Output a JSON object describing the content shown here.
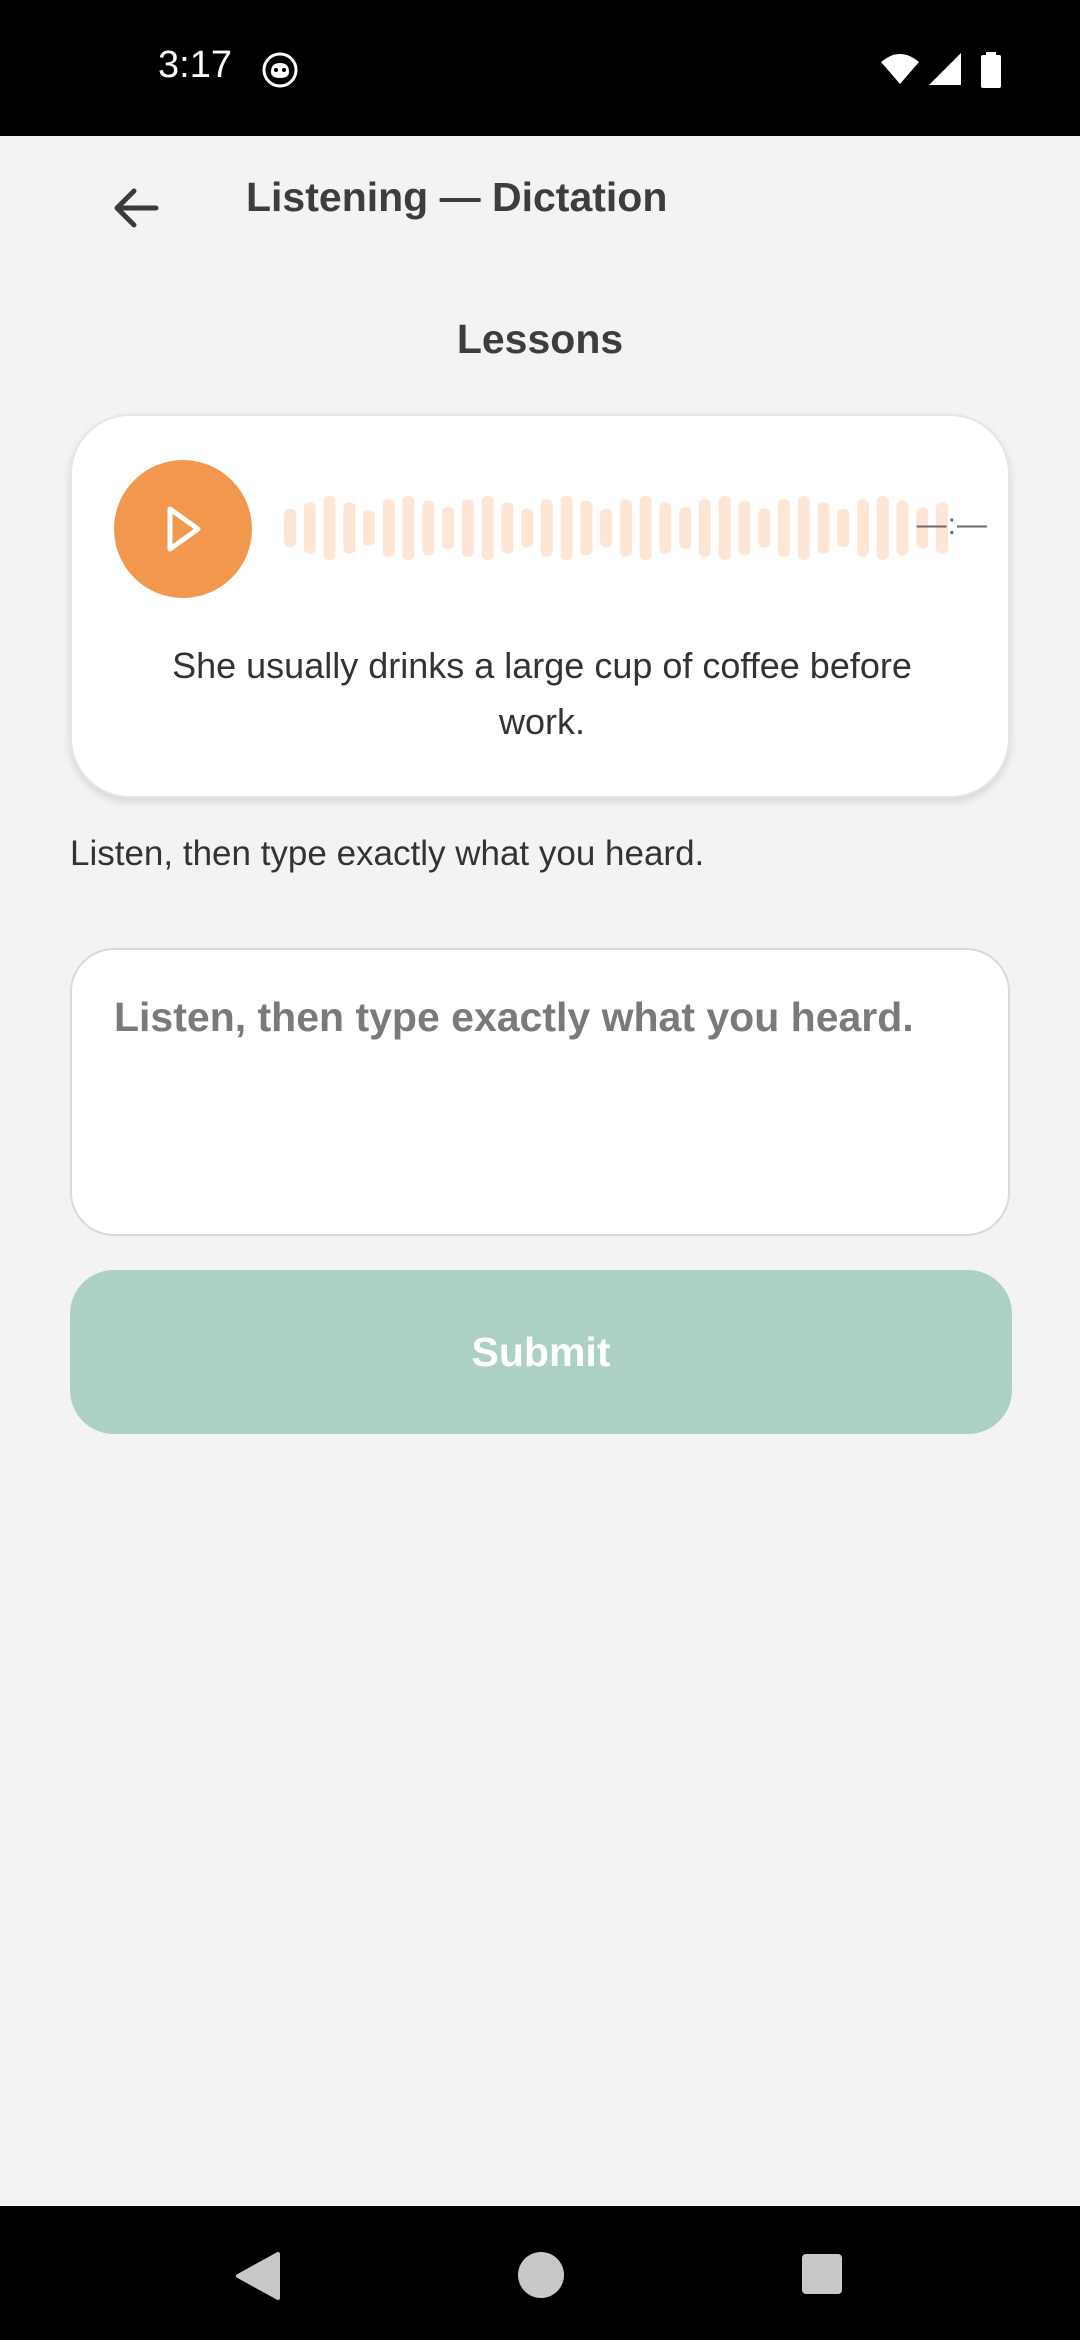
{
  "status_bar": {
    "time": "3:17",
    "icons": [
      "face-app-icon",
      "wifi-icon",
      "cell-signal-icon",
      "battery-icon"
    ]
  },
  "app_bar": {
    "back_icon": "arrow-left-icon",
    "title": "Listening — Dictation"
  },
  "section": {
    "title": "Lessons"
  },
  "player": {
    "play_icon": "play-icon",
    "duration": "—:—",
    "sentence": "She usually drinks a large cup of coffee before work.",
    "accent_color": "#f2974e",
    "waveform_color": "#fde6d6",
    "waveform_levels": [
      0.6,
      0.8,
      1,
      0.8,
      0.55,
      0.9,
      1,
      0.85,
      0.65,
      0.9,
      1,
      0.8,
      0.6,
      0.9,
      1,
      0.85,
      0.6,
      0.9,
      1,
      0.8,
      0.65,
      0.9,
      1,
      0.85,
      0.6,
      0.9,
      1,
      0.8,
      0.6,
      0.9,
      1,
      0.85,
      0.65,
      0.8
    ]
  },
  "instruction": "Listen, then type exactly what you heard.",
  "answer": {
    "placeholder": "Listen, then type exactly what you heard.",
    "value": ""
  },
  "submit": {
    "label": "Submit",
    "color": "#acd1c4"
  },
  "nav_bar": {
    "icons": [
      "nav-back-icon",
      "nav-home-icon",
      "nav-recents-icon"
    ]
  }
}
